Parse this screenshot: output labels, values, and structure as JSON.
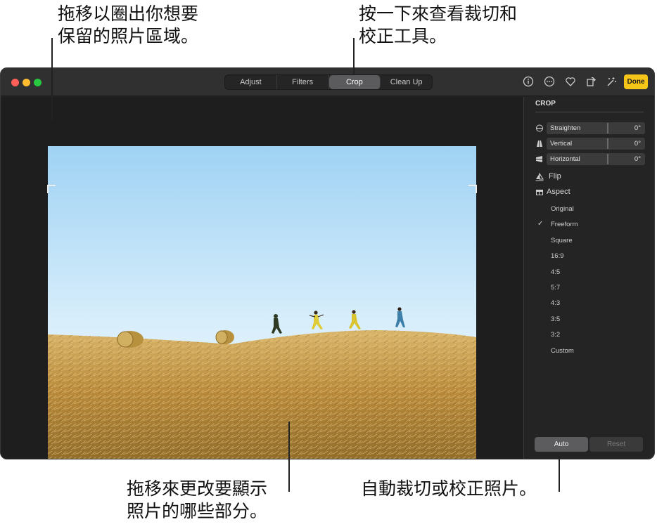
{
  "callouts": {
    "drag_to_crop": "拖移以圈出你想要\n保留的照片區域。",
    "click_crop_tools": "按一下來查看裁切和\n校正工具。",
    "drag_change_part": "拖移來更改要顯示\n照片的哪些部分。",
    "auto_crop": "自動裁切或校正照片。"
  },
  "toolbar": {
    "tabs": [
      {
        "label": "Adjust",
        "active": false
      },
      {
        "label": "Filters",
        "active": false
      },
      {
        "label": "Crop",
        "active": true
      },
      {
        "label": "Clean Up",
        "active": false
      }
    ],
    "icons": [
      "info-icon",
      "more-icon",
      "heart-icon",
      "rotate-icon",
      "auto-enhance-icon"
    ],
    "done_label": "Done",
    "accent": "#f5c518"
  },
  "sidebar": {
    "title": "CROP",
    "sliders": [
      {
        "label": "Straighten",
        "value": "0°",
        "icon": "straighten-icon"
      },
      {
        "label": "Vertical",
        "value": "0°",
        "icon": "vertical-icon"
      },
      {
        "label": "Horizontal",
        "value": "0°",
        "icon": "horizontal-icon"
      }
    ],
    "flip_label": "Flip",
    "aspect_label": "Aspect",
    "aspect_options": [
      "Original",
      "Freeform",
      "Square",
      "16:9",
      "4:5",
      "5:7",
      "4:3",
      "3:5",
      "3:2",
      "Custom"
    ],
    "aspect_selected": "Freeform",
    "auto_label": "Auto",
    "reset_label": "Reset"
  }
}
